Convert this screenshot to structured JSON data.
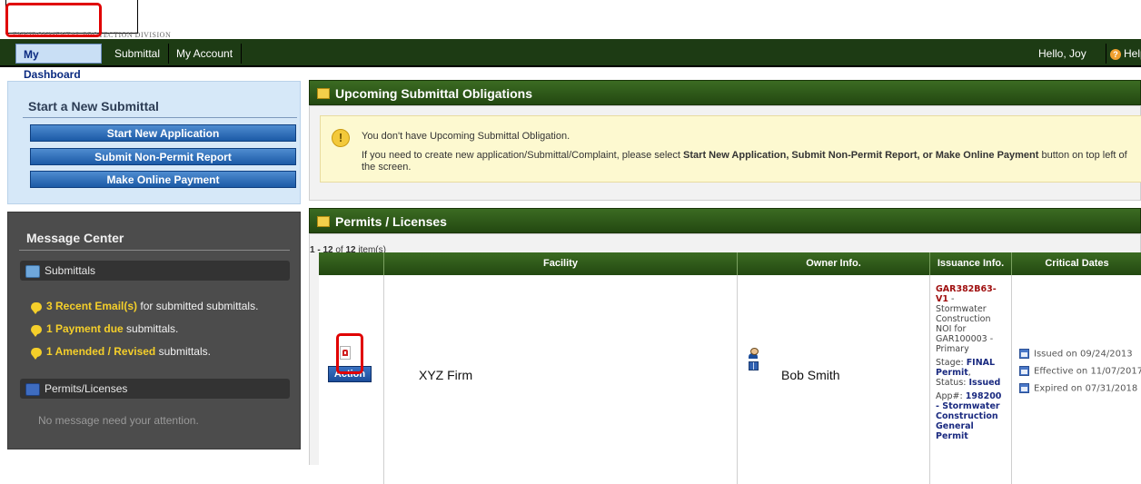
{
  "header": {
    "logo_subtitle": "ENVIRONMENTAL PROTECTION DIVISION"
  },
  "nav": {
    "tabs": [
      {
        "label": "My Dashboard",
        "active": true
      },
      {
        "label": "Submittal",
        "active": false
      },
      {
        "label": "My Account",
        "active": false
      }
    ],
    "greeting": "Hello, Joy",
    "help_label": "Help"
  },
  "start_panel": {
    "title": "Start a New Submittal",
    "buttons": [
      "Start New Application",
      "Submit Non-Permit Report",
      "Make Online Payment"
    ]
  },
  "message_center": {
    "title": "Message Center",
    "submittals_label": "Submittals",
    "items": [
      {
        "highlight": "3 Recent Email(s)",
        "rest": " for submitted submittals."
      },
      {
        "highlight": "1 Payment due",
        "rest": " submittals."
      },
      {
        "highlight": "1 Amended / Revised",
        "rest": " submittals."
      }
    ],
    "permits_label": "Permits/Licenses",
    "permits_empty": "No message need your attention."
  },
  "obligations": {
    "title": "Upcoming Submittal Obligations",
    "message": "You don't have Upcoming Submittal Obligation.",
    "instruction_prefix": "If you need to create new application/Submittal/Complaint, please select ",
    "instruction_bold": "Start New Application, Submit Non-Permit Report, or Make Online Payment",
    "instruction_suffix": " button on top left of the screen."
  },
  "permits": {
    "title": "Permits / Licenses",
    "pager_range": "1 - 12",
    "pager_rest": " of ",
    "pager_total": "12",
    "pager_suffix": " item(s)",
    "columns": [
      "",
      "Facility",
      "Owner Info.",
      "Issuance Info.",
      "Critical Dates"
    ],
    "row": {
      "action_label": "Action",
      "facility": "XYZ Firm",
      "owner": "Bob Smith",
      "permit_id": "GAR382B63-V1",
      "permit_desc": " - Stormwater Construction NOI for GAR100003 - Primary",
      "stage_label": "Stage: ",
      "stage_value": "FINAL Permit",
      "status_label": ", Status: ",
      "status_value": "Issued",
      "app_label": "App#: ",
      "app_value": "198200 - Stormwater Construction General Permit",
      "dates": [
        "Issued on 09/24/2013",
        "Effective on 11/07/2017",
        "Expired on 07/31/2018"
      ]
    }
  },
  "colors": {
    "nav_bg": "#1d3b14",
    "header_green": "#2e5a19",
    "button_blue": "#1b5aa6",
    "highlight_yellow": "#f5cf2a",
    "annotation_red": "#e00000"
  }
}
